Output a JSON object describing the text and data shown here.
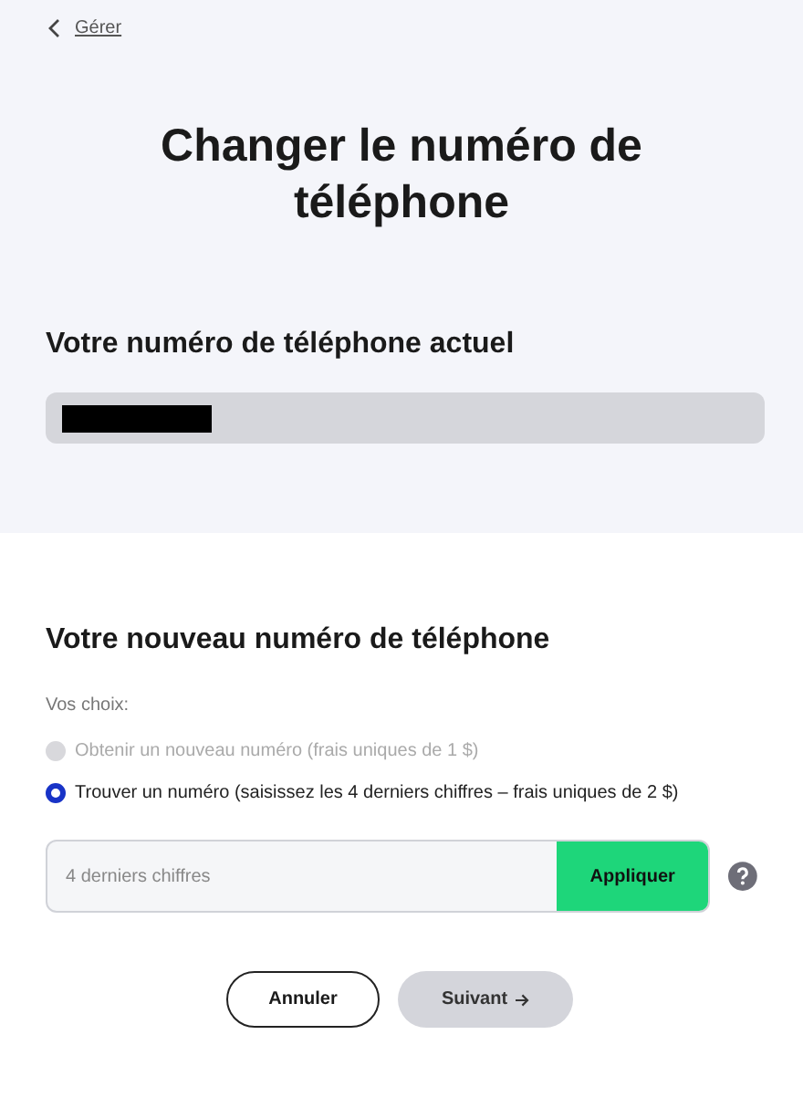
{
  "back_link": {
    "label": "Gérer"
  },
  "title": "Changer le numéro de téléphone",
  "current": {
    "heading": "Votre numéro de téléphone actuel",
    "redacted": true
  },
  "new_number": {
    "heading": "Votre nouveau numéro de téléphone",
    "choices_label": "Vos choix:",
    "options": [
      {
        "label": "Obtenir un nouveau numéro (frais uniques de 1 $)",
        "selected": false,
        "disabled": true
      },
      {
        "label": "Trouver un numéro (saisissez les 4 derniers chiffres – frais uniques de 2 $)",
        "selected": true,
        "disabled": false
      }
    ],
    "search": {
      "placeholder": "4 derniers chiffres",
      "button": "Appliquer"
    }
  },
  "actions": {
    "cancel": "Annuler",
    "next": "Suivant",
    "next_disabled": true
  }
}
